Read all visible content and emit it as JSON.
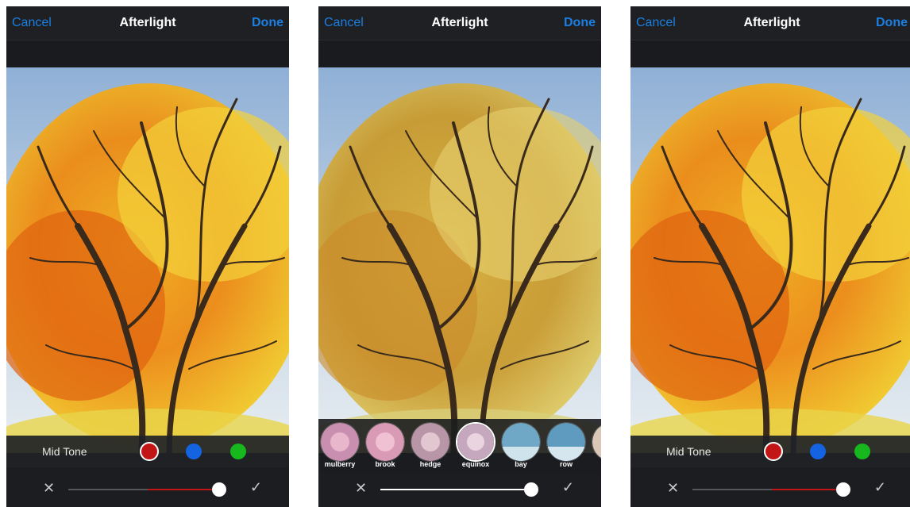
{
  "screens": [
    {
      "nav": {
        "cancel": "Cancel",
        "title": "Afterlight",
        "done": "Done"
      },
      "tone": {
        "label": "Mid Tone",
        "swatches": [
          "#c21515",
          "#1463e0",
          "#16b81e"
        ],
        "selected": "red"
      },
      "slider": {
        "value": 0.98,
        "fill_color": "#c21515"
      }
    },
    {
      "nav": {
        "cancel": "Cancel",
        "title": "Afterlight",
        "done": "Done"
      },
      "filters": [
        "mulberry",
        "brook",
        "hedge",
        "equinox",
        "bay",
        "row"
      ],
      "selected_filter": "equinox",
      "slider": {
        "value": 1.0,
        "fill_color": "#ffffff"
      }
    },
    {
      "nav": {
        "cancel": "Cancel",
        "title": "Afterlight",
        "done": "Done"
      },
      "tone": {
        "label": "Mid Tone",
        "swatches": [
          "#c21515",
          "#1463e0",
          "#16b81e"
        ],
        "selected": "red"
      },
      "slider": {
        "value": 0.98,
        "fill_color": "#c21515"
      }
    }
  ],
  "icons": {
    "close": "close-icon",
    "confirm": "checkmark-icon"
  }
}
